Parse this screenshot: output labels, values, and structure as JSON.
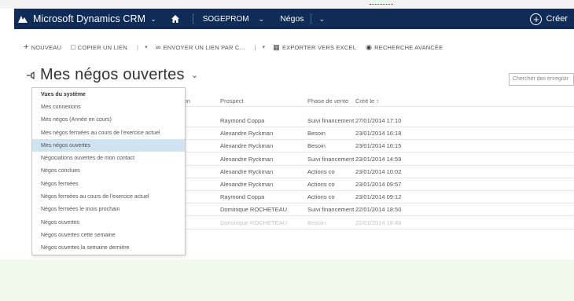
{
  "navbar": {
    "app_title": "Microsoft Dynamics CRM",
    "org": "SOGEPROM",
    "area": "Négos",
    "create_label": "Créer",
    "color": "#0f2b57"
  },
  "commandbar": {
    "new_label": "NOUVEAU",
    "copy_link_label": "COPIER UN LIEN",
    "send_link_label": "ENVOYER UN LIEN PAR C...",
    "export_label": "EXPORTER VERS EXCEL",
    "advanced_search_label": "RECHERCHE AVANCÉE"
  },
  "view": {
    "title": "Mes négos ouvertes",
    "search_placeholder": "Chercher des enregistr"
  },
  "grid": {
    "left_header": "ion",
    "columns": [
      "Prospect",
      "Phase de vente",
      "Créé le ↑"
    ],
    "rows": [
      [
        "Raymond Coppa",
        "Suivi financement",
        "27/01/2014 17:10"
      ],
      [
        "Alexandre Ryckman",
        "Besoin",
        "23/01/2014 16:18"
      ],
      [
        "Alexandre Ryckman",
        "Besoin",
        "23/01/2014 16:15"
      ],
      [
        "Alexandre Ryckman",
        "Suivi financement",
        "23/01/2014 14:59"
      ],
      [
        "Alexandre Ryckman",
        "Actions co",
        "23/01/2014 10:02"
      ],
      [
        "Alexandre Ryckman",
        "Actions co",
        "23/01/2014 09:57"
      ],
      [
        "Raymond Coppa",
        "Actions co",
        "23/01/2014 09:12"
      ],
      [
        "Dominique ROCHETEAU",
        "Suivi financement",
        "22/01/2014 18:50"
      ],
      [
        "Dominique ROCHETEAU",
        "Besoin",
        "22/01/2014 18:48"
      ]
    ]
  },
  "view_menu": {
    "header": "Vues du système",
    "items": [
      "Mes connexions",
      "Mes négos (Année en cours)",
      "Mes négos fermées au cours de l'exercice actuel",
      "Mes négos ouvertes",
      "Négociations ouvertes de mon contact",
      "Négos conclues",
      "Négos fermées",
      "Négos fermées au cours de l'exercice actuel",
      "Négos fermées le mois prochain",
      "Négos ouvertes",
      "Négos ouvertes cette semaine",
      "Négos ouvertes la semaine dernière"
    ],
    "selected_index": 3
  }
}
